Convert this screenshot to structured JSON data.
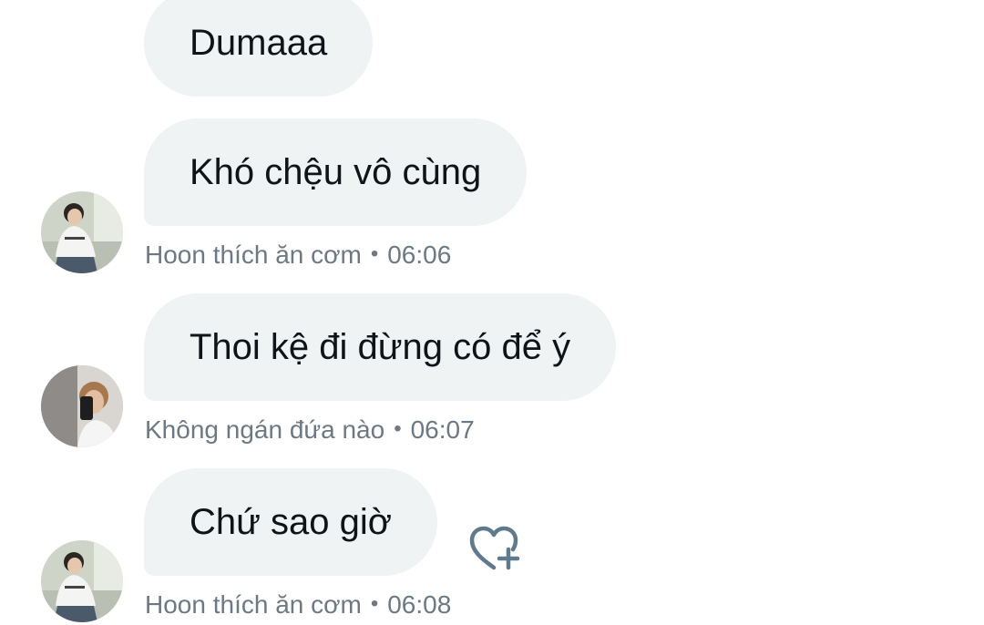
{
  "messages": [
    {
      "text": "Dumaaa"
    },
    {
      "text": "Khó chệu vô cùng"
    },
    {
      "text": "Thoi kệ đi đừng có để ý"
    },
    {
      "text": "Chứ sao giờ"
    }
  ],
  "metas": [
    {
      "sender": "Hoon thích ăn cơm",
      "separator": "•",
      "time": "06:06"
    },
    {
      "sender": "Không ngán đứa nào",
      "separator": "•",
      "time": "06:07"
    },
    {
      "sender": "Hoon thích ăn cơm",
      "separator": "•",
      "time": "06:08"
    }
  ],
  "icons": {
    "avatar_a": "avatar-hoon",
    "avatar_b": "avatar-khong-ngan",
    "reaction": "heart-plus-icon"
  },
  "colors": {
    "bubble": "#eff3f4",
    "meta_text": "#6c7884",
    "reaction_icon": "#5f7a8c",
    "message_text": "#0f1419"
  }
}
